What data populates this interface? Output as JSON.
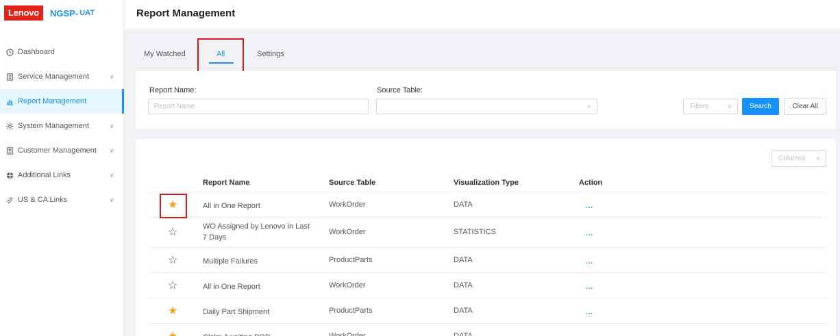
{
  "brand": {
    "logo": "Lenovo",
    "name": "NGSP-",
    "env": "UAT"
  },
  "sidebar": {
    "items": [
      {
        "label": "Dashboard",
        "icon": "clock-icon",
        "chevron": false,
        "active": false
      },
      {
        "label": "Service Management",
        "icon": "document-icon",
        "chevron": true,
        "active": false
      },
      {
        "label": "Report Management",
        "icon": "bar-chart-icon",
        "chevron": false,
        "active": true
      },
      {
        "label": "System Management",
        "icon": "gear-icon",
        "chevron": true,
        "active": false
      },
      {
        "label": "Customer Management",
        "icon": "document-icon",
        "chevron": true,
        "active": false
      },
      {
        "label": "Additional Links",
        "icon": "globe-icon",
        "chevron": true,
        "active": false
      },
      {
        "label": "US & CA Links",
        "icon": "link-icon",
        "chevron": true,
        "active": false
      }
    ]
  },
  "header": {
    "title": "Report Management"
  },
  "tabs": [
    {
      "label": "My Watched",
      "active": false
    },
    {
      "label": "All",
      "active": true
    },
    {
      "label": "Settings",
      "active": false
    }
  ],
  "filters": {
    "report_name_label": "Report Name:",
    "report_name_placeholder": "Report Name",
    "source_table_label": "Source Table:",
    "source_table_value": "",
    "filters_select": "Filters",
    "search_label": "Search",
    "clear_label": "Clear All"
  },
  "table": {
    "columns_button": "Columns",
    "headers": {
      "name": "Report Name",
      "source": "Source Table",
      "viz": "Visualization Type",
      "action": "Action"
    },
    "rows": [
      {
        "starred": true,
        "name": "All in One Report",
        "source": "WorkOrder",
        "viz": "DATA",
        "action": "..."
      },
      {
        "starred": false,
        "name": "WO Assigned by Lenovo in Last 7 Days",
        "source": "WorkOrder",
        "viz": "STATISTICS",
        "action": "..."
      },
      {
        "starred": false,
        "name": "Multiple Failures",
        "source": "ProductParts",
        "viz": "DATA",
        "action": "..."
      },
      {
        "starred": false,
        "name": "All in One Report",
        "source": "WorkOrder",
        "viz": "DATA",
        "action": "..."
      },
      {
        "starred": true,
        "name": "Daily Part Shipment",
        "source": "ProductParts",
        "viz": "DATA",
        "action": "..."
      },
      {
        "starred": true,
        "name": "Claim Awaiting POP",
        "source": "WorkOrder",
        "viz": "DATA",
        "action": "..."
      }
    ]
  },
  "colors": {
    "accent": "#1890ff",
    "brand_red": "#e2231a",
    "star": "#f5a623",
    "highlight": "#e0151a"
  }
}
